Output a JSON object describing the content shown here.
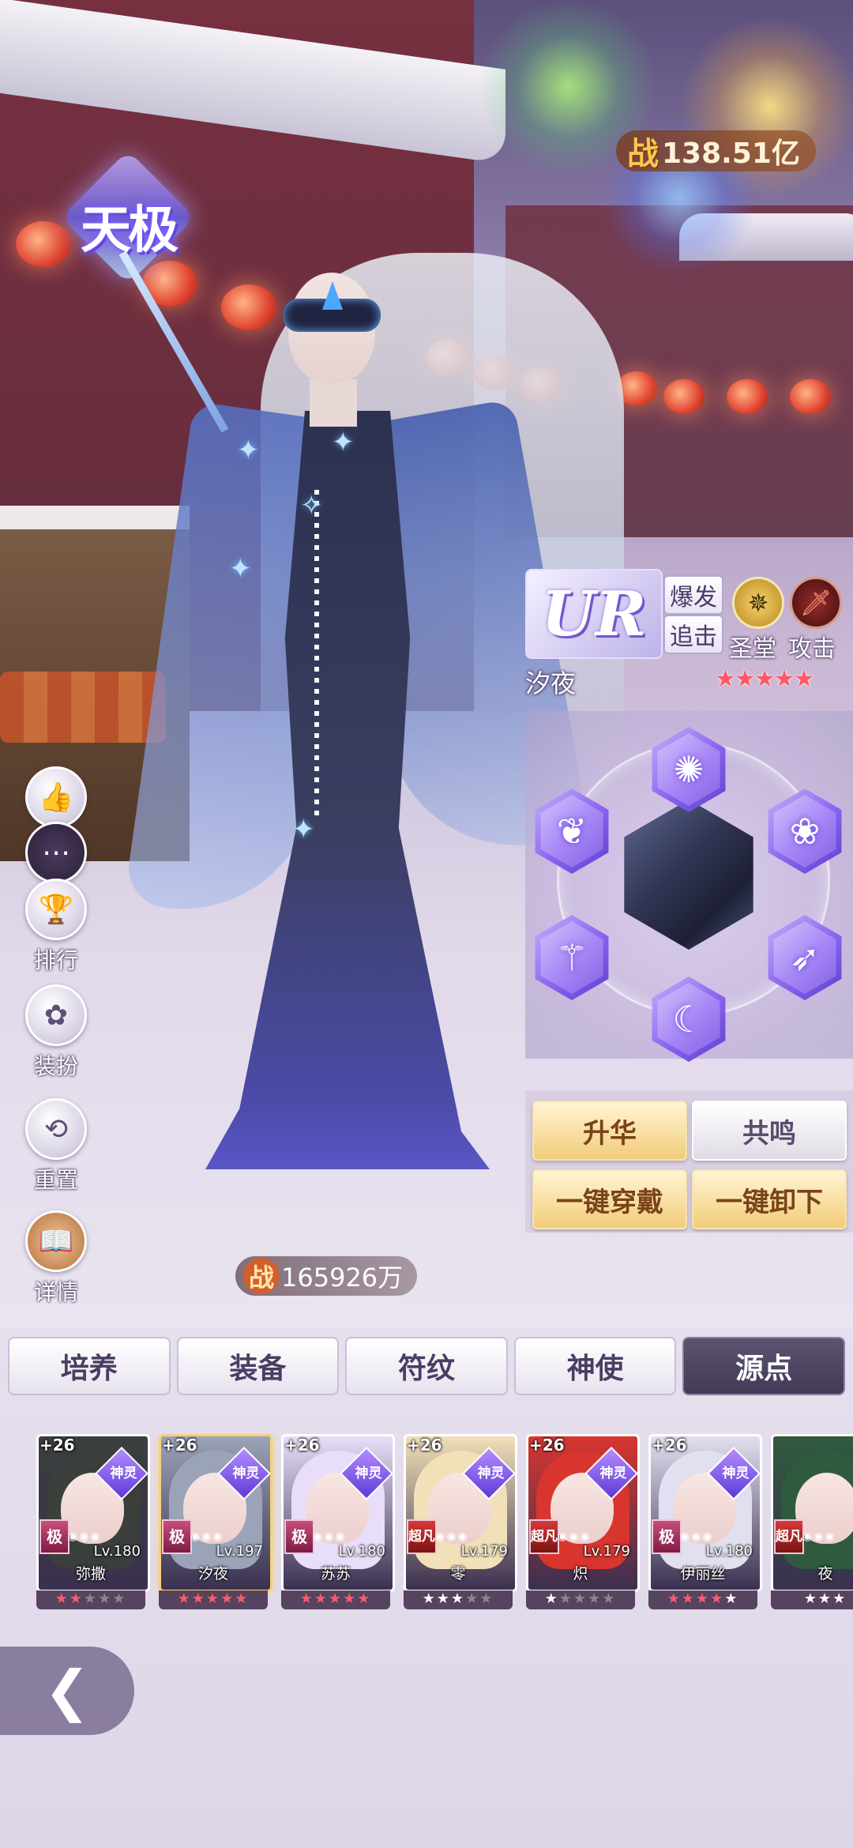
{
  "header": {
    "tier_badge": "天极",
    "power_label": "战",
    "power_value": "138.51亿"
  },
  "side_menu": [
    {
      "icon": "thumbs-up-icon",
      "label": ""
    },
    {
      "icon": "chat-icon",
      "label": ""
    },
    {
      "icon": "trophy-icon",
      "label": "排行"
    },
    {
      "icon": "outfit-icon",
      "label": "装扮"
    },
    {
      "icon": "reset-icon",
      "label": "重置"
    },
    {
      "icon": "book-icon",
      "label": "详情"
    }
  ],
  "character": {
    "rarity": "UR",
    "tags": [
      "爆发",
      "追击"
    ],
    "roles": [
      {
        "icon": "holy-hall-icon",
        "label": "圣堂"
      },
      {
        "icon": "sword-icon",
        "label": "攻击"
      }
    ],
    "name": "汐夜",
    "stars": "★★★★★",
    "power_label": "战",
    "power_value": "165926万"
  },
  "rune_slots": [
    {
      "icon": "swirl-rune-icon",
      "glyph": "✺"
    },
    {
      "icon": "heart-rune-icon",
      "glyph": "❦"
    },
    {
      "icon": "lotus-rune-icon",
      "glyph": "❀"
    },
    {
      "icon": "staff-rune-icon",
      "glyph": "⚚"
    },
    {
      "icon": "feather-rune-icon",
      "glyph": "➶"
    },
    {
      "icon": "moon-rune-icon",
      "glyph": "☾"
    }
  ],
  "actions": {
    "ascend": "升华",
    "resonate": "共鸣",
    "equip_all": "一键穿戴",
    "unequip_all": "一键卸下"
  },
  "tabs": [
    {
      "label": "培养",
      "active": false
    },
    {
      "label": "装备",
      "active": false
    },
    {
      "label": "符纹",
      "active": false
    },
    {
      "label": "神使",
      "active": false
    },
    {
      "label": "源点",
      "active": true
    }
  ],
  "roster": [
    {
      "name": "弥撒",
      "plus": "+26",
      "badge": "神灵",
      "grade": "极",
      "level": "Lv.180",
      "stars": [
        2,
        0,
        3
      ],
      "hair": "#3a3f3c"
    },
    {
      "name": "汐夜",
      "plus": "+26",
      "badge": "神灵",
      "grade": "极",
      "level": "Lv.197",
      "stars": [
        5,
        0,
        0
      ],
      "hair": "#9aa3b8",
      "selected": true
    },
    {
      "name": "苏苏",
      "plus": "+26",
      "badge": "神灵",
      "grade": "极",
      "level": "Lv.180",
      "stars": [
        5,
        0,
        0
      ],
      "hair": "#e8defa"
    },
    {
      "name": "零",
      "plus": "+26",
      "badge": "神灵",
      "grade": "超凡",
      "level": "Lv.179",
      "stars": [
        0,
        3,
        2
      ],
      "hair": "#f1e0b8"
    },
    {
      "name": "炽",
      "plus": "+26",
      "badge": "神灵",
      "grade": "超凡",
      "level": "Lv.179",
      "stars": [
        0,
        1,
        4
      ],
      "hair": "#d8352f"
    },
    {
      "name": "伊丽丝",
      "plus": "+26",
      "badge": "神灵",
      "grade": "极",
      "level": "Lv.180",
      "stars": [
        4,
        1,
        0
      ],
      "hair": "#e2e0f0"
    },
    {
      "name": "夜",
      "plus": "",
      "badge": "",
      "grade": "超凡",
      "level": "",
      "stars": [
        0,
        3,
        0
      ],
      "hair": "#2f5a3e"
    }
  ],
  "nav": {
    "back_icon": "back-chevron-icon",
    "back_glyph": "❮"
  }
}
